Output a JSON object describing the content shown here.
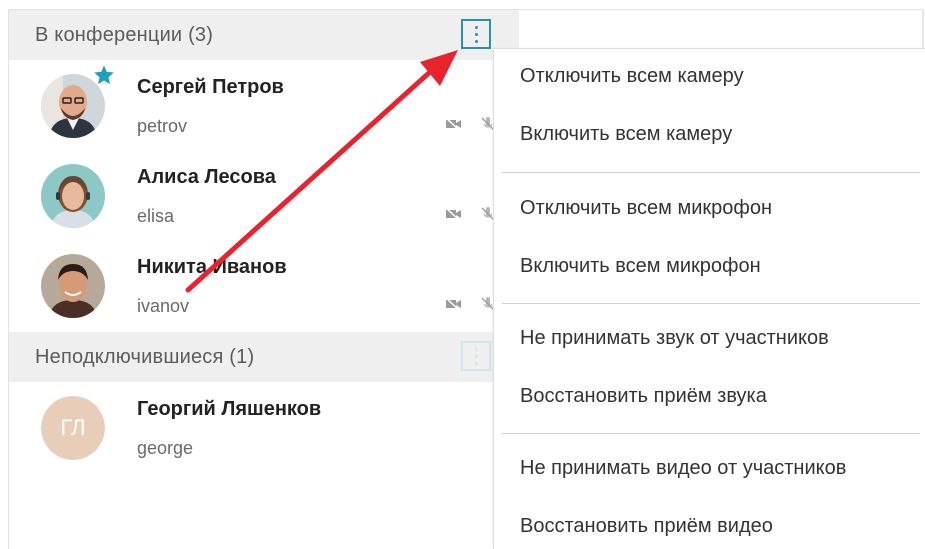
{
  "groups": {
    "in_conference": {
      "title": "В конференции (3)"
    },
    "not_connected": {
      "title": "Неподключившиеся (1)"
    }
  },
  "participants": [
    {
      "name": "Сергей Петров",
      "login": "petrov",
      "badge": "star-icon"
    },
    {
      "name": "Алиса Лесова",
      "login": "elisa"
    },
    {
      "name": "Никита Иванов",
      "login": "ivanov"
    }
  ],
  "pending": [
    {
      "name": "Георгий Ляшенков",
      "login": "george",
      "initials": "ГЛ"
    }
  ],
  "menu": {
    "items": [
      "Отключить всем камеру",
      "Включить всем камеру",
      "Отключить всем микрофон",
      "Включить всем микрофон",
      "Не принимать звук от участников",
      "Восстановить приём звука",
      "Не принимать видео от участников",
      "Восстановить приём видео"
    ]
  },
  "colors": {
    "accent": "#2a93a3",
    "arrow": "#e8232d",
    "header_bg": "#efefef",
    "initials_bg": "#e8cdb8"
  },
  "icons": [
    "more-vertical-icon",
    "star-icon",
    "camera-off-icon",
    "mic-off-icon",
    "red-pointer-arrow"
  ]
}
